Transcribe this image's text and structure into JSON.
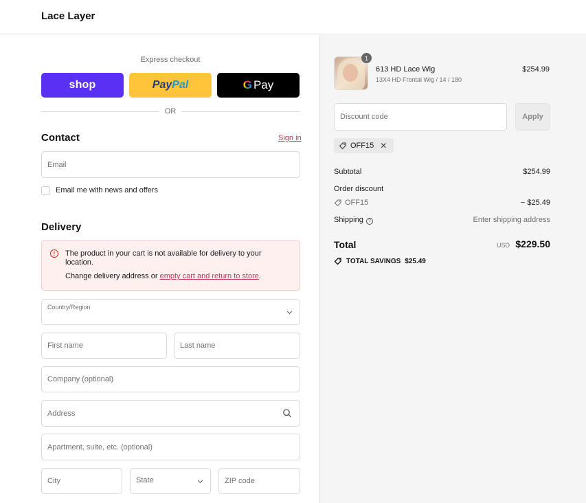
{
  "header": {
    "store_name": "Lace Layer"
  },
  "express": {
    "label": "Express checkout",
    "shop_label": "shop",
    "paypal_part1": "Pay",
    "paypal_part2": "Pal",
    "gpay_g": "G",
    "gpay_label": "Pay",
    "or_label": "OR"
  },
  "contact": {
    "title": "Contact",
    "signin_label": "Sign in",
    "email_placeholder": "Email",
    "newsletter_label": "Email me with news and offers"
  },
  "delivery": {
    "title": "Delivery",
    "alert_message": "The product in your cart is not available for delivery to your location.",
    "alert_prefix": "Change delivery address or ",
    "alert_link": "empty cart and return to store",
    "alert_suffix": ".",
    "country_label": "Country/Region",
    "first_name_placeholder": "First name",
    "last_name_placeholder": "Last name",
    "company_placeholder": "Company (optional)",
    "address_placeholder": "Address",
    "apartment_placeholder": "Apartment, suite, etc. (optional)",
    "city_placeholder": "City",
    "state_label": "State",
    "zip_placeholder": "ZIP code"
  },
  "cart": {
    "quantity": "1",
    "item_name": "613 HD Lace Wig",
    "item_variant": "13X4 HD Frontal Wig / 14 / 180",
    "item_price": "$254.99"
  },
  "discount": {
    "placeholder": "Discount code",
    "apply_label": "Apply",
    "applied_code": "OFF15",
    "remove_icon": "close-icon"
  },
  "summary": {
    "subtotal_label": "Subtotal",
    "subtotal_value": "$254.99",
    "order_discount_label": "Order discount",
    "discount_code": "OFF15",
    "discount_value": "− $25.49",
    "shipping_label": "Shipping",
    "shipping_value": "Enter shipping address",
    "total_label": "Total",
    "total_currency": "USD",
    "total_value": "$229.50",
    "savings_label": "TOTAL SAVINGS",
    "savings_value": "$25.49"
  },
  "colors": {
    "shop_pay": "#5a31f4",
    "paypal": "#ffc439",
    "gpay": "#000000",
    "link": "#c0395a",
    "alert_bg": "#fff0f0",
    "alert_icon": "#d72c0d"
  }
}
